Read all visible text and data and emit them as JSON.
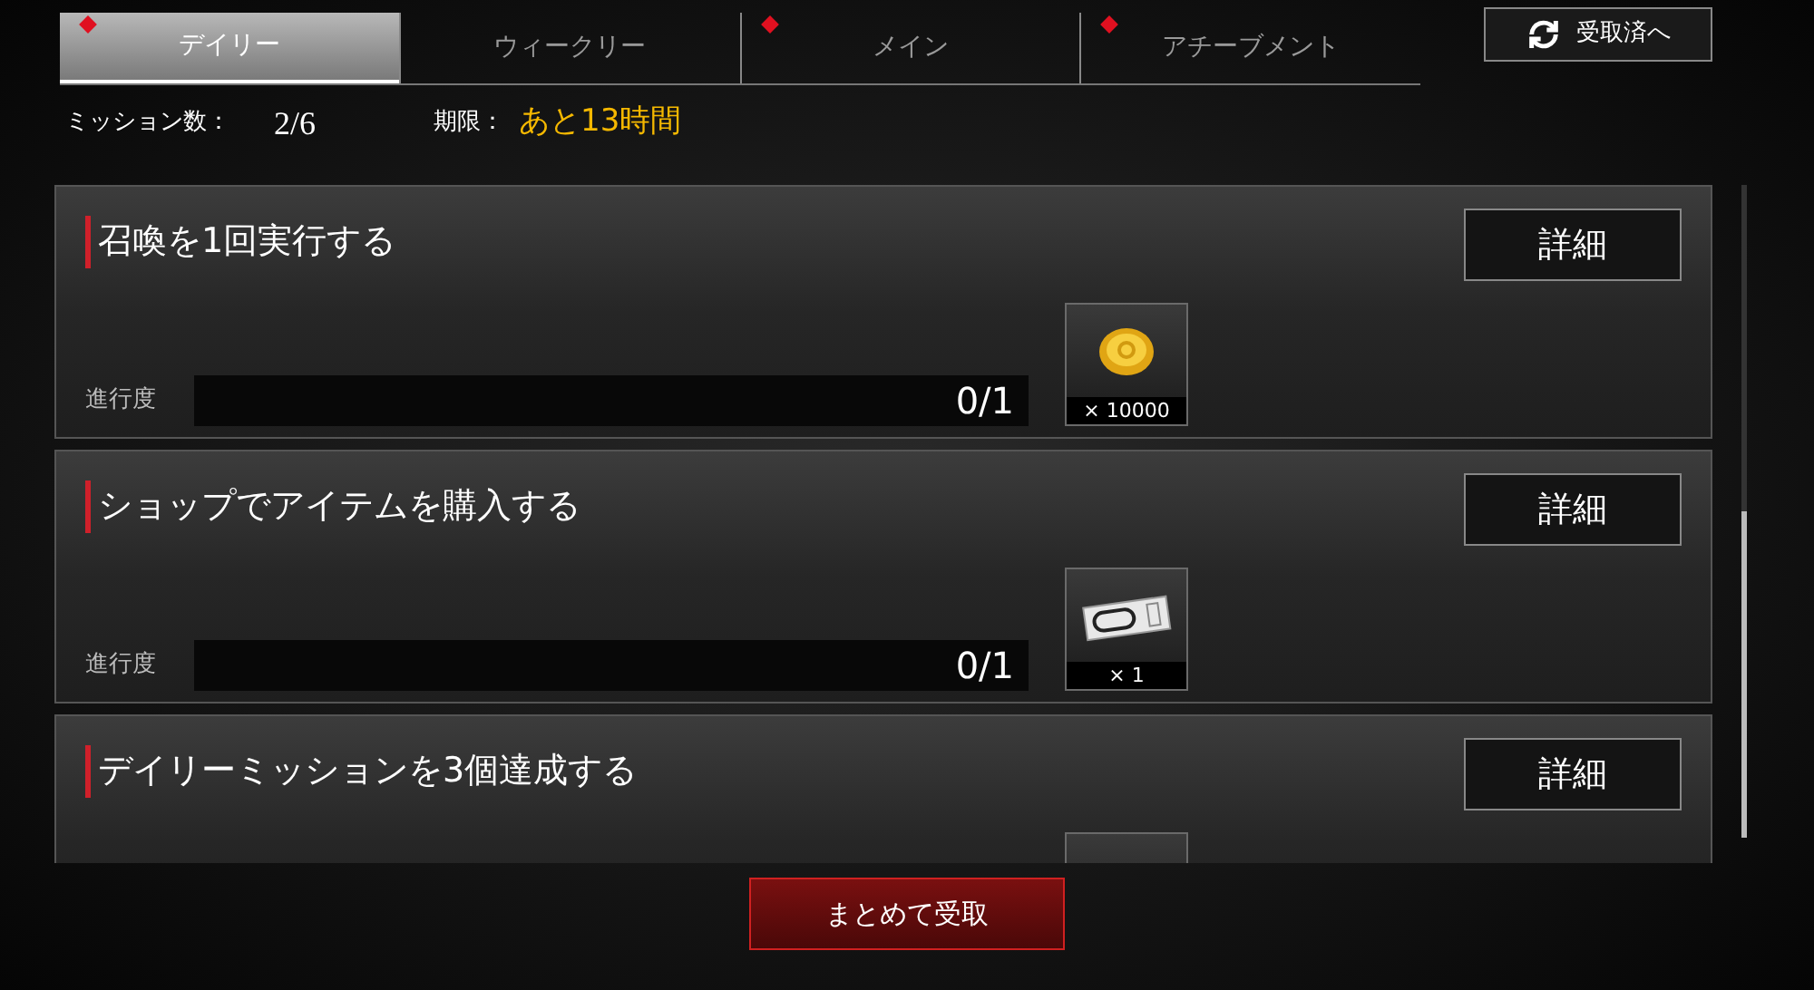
{
  "tabs": [
    {
      "label": "デイリー",
      "selected": true,
      "badge": true
    },
    {
      "label": "ウィークリー",
      "selected": false,
      "badge": false
    },
    {
      "label": "メイン",
      "selected": false,
      "badge": true
    },
    {
      "label": "アチーブメント",
      "selected": false,
      "badge": true
    }
  ],
  "received_button": "受取済へ",
  "summary": {
    "count_label": "ミッション数：",
    "count": "2/6",
    "deadline_label": "期限：",
    "deadline": "あと13時間"
  },
  "missions": [
    {
      "title": "召喚を1回実行する",
      "detail_button": "詳細",
      "progress_label": "進行度",
      "progress": "0/1",
      "level": 0,
      "reward": {
        "kind": "coin",
        "quantity": "× 10000"
      }
    },
    {
      "title": "ショップでアイテムを購入する",
      "detail_button": "詳細",
      "progress_label": "進行度",
      "progress": "0/1",
      "level": 0,
      "reward": {
        "kind": "ticket",
        "quantity": "× 1"
      }
    },
    {
      "title": "デイリーミッションを3個達成する",
      "detail_button": "詳細",
      "reward": {
        "kind": "hidden"
      }
    }
  ],
  "claim_all_button": "まとめて受取"
}
